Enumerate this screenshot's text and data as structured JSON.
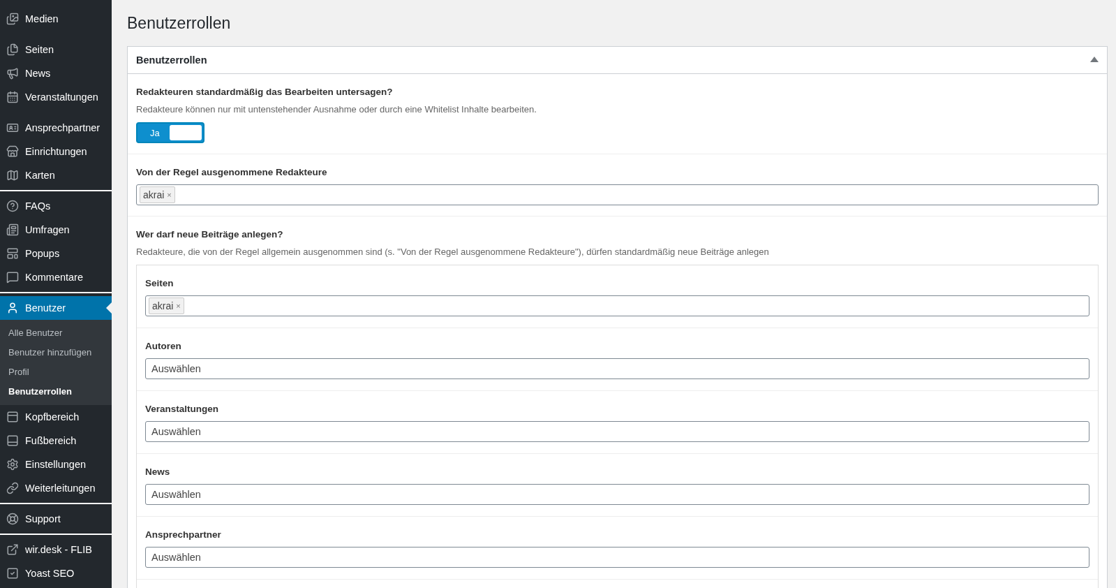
{
  "sidebar": {
    "sections": [
      {
        "line_below": false,
        "items": [
          {
            "label": "Medien",
            "selected": false
          }
        ]
      },
      {
        "line_below": false,
        "items": [
          {
            "label": "Seiten",
            "selected": false
          },
          {
            "label": "News",
            "selected": false
          },
          {
            "label": "Veranstaltungen",
            "selected": false
          }
        ]
      },
      {
        "line_below": true,
        "items": [
          {
            "label": "Ansprechpartner",
            "selected": false
          },
          {
            "label": "Einrichtungen",
            "selected": false
          },
          {
            "label": "Karten",
            "selected": false
          }
        ]
      },
      {
        "line_below": true,
        "items": [
          {
            "label": "FAQs",
            "selected": false
          },
          {
            "label": "Umfragen",
            "selected": false
          },
          {
            "label": "Popups",
            "selected": false
          },
          {
            "label": "Kommentare",
            "selected": false
          }
        ]
      },
      {
        "line_below": true,
        "items": [
          {
            "label": "Benutzer",
            "selected": true,
            "submenu": [
              {
                "label": "Alle Benutzer",
                "selected": false
              },
              {
                "label": "Benutzer hinzufügen",
                "selected": false
              },
              {
                "label": "Profil",
                "selected": false
              },
              {
                "label": "Benutzerrollen",
                "selected": true
              }
            ]
          },
          {
            "label": "Kopfbereich",
            "selected": false
          },
          {
            "label": "Fußbereich",
            "selected": false
          },
          {
            "label": "Einstellungen",
            "selected": false
          },
          {
            "label": "Weiterleitungen",
            "selected": false
          }
        ]
      },
      {
        "line_below": true,
        "items": [
          {
            "label": "Support",
            "selected": false
          }
        ]
      },
      {
        "line_below": false,
        "items": [
          {
            "label": "wir.desk - FLIB",
            "selected": false
          },
          {
            "label": "Yoast SEO",
            "selected": false
          }
        ]
      }
    ]
  },
  "page_title": "Benutzerrollen",
  "panel": {
    "title": "Benutzerrollen",
    "expanded": true,
    "sections": [
      {
        "kind": "toggle",
        "label": "Redakteuren standardmäßig das Bearbeiten untersagen?",
        "description": "Redakteure können nur mit untenstehender Ausnahme oder durch eine Whitelist Inhalte bearbeiten.",
        "toggle": {
          "text": "Ja",
          "on": true
        }
      },
      {
        "kind": "select",
        "label": "Von der Regel ausgenommene Redakteure",
        "tags": [
          {
            "text": "akrai",
            "remove": "×"
          }
        ]
      },
      {
        "kind": "group",
        "label": "Wer darf neue Beiträge anlegen?",
        "description": "Redakteure, die von der Regel allgemein ausgenommen sind (s. \"Von der Regel ausgenommene Redakteure\"), dürfen standardmäßig neue Beiträge anlegen",
        "fields": [
          {
            "label": "Seiten",
            "tags": [
              {
                "text": "akrai",
                "remove": "×"
              }
            ]
          },
          {
            "label": "Autoren",
            "placeholder": "Auswählen"
          },
          {
            "label": "Veranstaltungen",
            "placeholder": "Auswählen"
          },
          {
            "label": "News",
            "placeholder": "Auswählen"
          },
          {
            "label": "Ansprechpartner",
            "placeholder": "Auswählen"
          }
        ]
      }
    ]
  }
}
